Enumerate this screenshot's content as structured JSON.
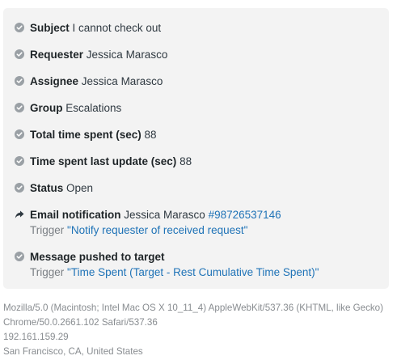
{
  "events": [
    {
      "icon": "check-circle-icon",
      "label": "Subject",
      "value": "I cannot check out"
    },
    {
      "icon": "check-circle-icon",
      "label": "Requester",
      "value": "Jessica Marasco"
    },
    {
      "icon": "check-circle-icon",
      "label": "Assignee",
      "value": "Jessica Marasco"
    },
    {
      "icon": "check-circle-icon",
      "label": "Group",
      "value": "Escalations"
    },
    {
      "icon": "check-circle-icon",
      "label": "Total time spent (sec)",
      "value": "88"
    },
    {
      "icon": "check-circle-icon",
      "label": "Time spent last update (sec)",
      "value": "88"
    },
    {
      "icon": "check-circle-icon",
      "label": "Status",
      "value": "Open"
    },
    {
      "icon": "share-arrow-icon",
      "label": "Email notification",
      "value": "Jessica Marasco",
      "link": "#98726537146",
      "trigger_prefix": "Trigger",
      "trigger_name": "\"Notify requester of received request\""
    },
    {
      "icon": "check-circle-icon",
      "label": "Message pushed to target",
      "trigger_prefix": "Trigger",
      "trigger_name": "\"Time Spent (Target - Rest Cumulative Time Spent)\""
    }
  ],
  "client_info": {
    "user_agent_line1": "Mozilla/5.0 (Macintosh; Intel Mac OS X 10_11_4) AppleWebKit/537.36 (KHTML, like Gecko)",
    "user_agent_line2": "Chrome/50.0.2661.102 Safari/537.36",
    "ip": "192.161.159.29",
    "location": "San Francisco, CA, United States"
  },
  "colors": {
    "panel_bg": "#f3f3f3",
    "link": "#1f73b7",
    "icon": "#9aa0a5"
  }
}
